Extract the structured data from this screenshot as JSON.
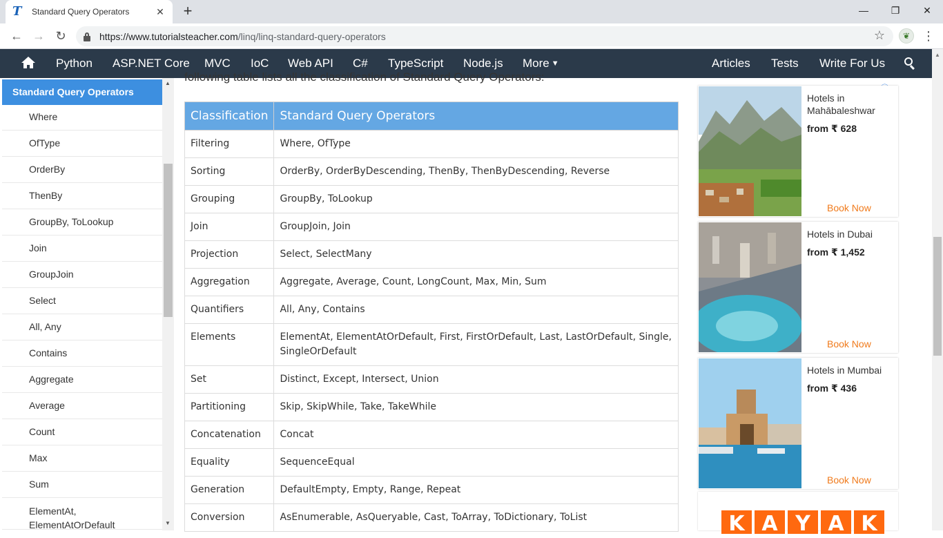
{
  "browser": {
    "tab_title": "Standard Query Operators",
    "url_host": "https://www.tutorialsteacher.com",
    "url_path": "/linq/linq-standard-query-operators"
  },
  "sitenav": {
    "items": [
      "Python",
      "ASP.NET Core",
      "MVC",
      "IoC",
      "Web API",
      "C#",
      "TypeScript",
      "Node.js",
      "More"
    ],
    "right_items": [
      "Articles",
      "Tests",
      "Write For Us"
    ]
  },
  "sidebar": {
    "header": "Standard Query Operators",
    "items": [
      "Where",
      "OfType",
      "OrderBy",
      "ThenBy",
      "GroupBy, ToLookup",
      "Join",
      "GroupJoin",
      "Select",
      "All, Any",
      "Contains",
      "Aggregate",
      "Average",
      "Count",
      "Max",
      "Sum"
    ],
    "last_item_line1": "ElementAt,",
    "last_item_line2": "ElementAtOrDefault"
  },
  "main": {
    "intro": "following table lists all the classification of Standard Query Operators:",
    "table_headers": [
      "Classification",
      "Standard Query Operators"
    ],
    "rows": [
      [
        "Filtering",
        "Where, OfType"
      ],
      [
        "Sorting",
        "OrderBy, OrderByDescending, ThenBy, ThenByDescending, Reverse"
      ],
      [
        "Grouping",
        "GroupBy, ToLookup"
      ],
      [
        "Join",
        "GroupJoin, Join"
      ],
      [
        "Projection",
        "Select, SelectMany"
      ],
      [
        "Aggregation",
        "Aggregate, Average, Count, LongCount, Max, Min, Sum"
      ],
      [
        "Quantifiers",
        "All, Any, Contains"
      ],
      [
        "Elements",
        "ElementAt, ElementAtOrDefault, First, FirstOrDefault, Last, LastOrDefault, Single, SingleOrDefault"
      ],
      [
        "Set",
        "Distinct, Except, Intersect, Union"
      ],
      [
        "Partitioning",
        "Skip, SkipWhile, Take, TakeWhile"
      ],
      [
        "Concatenation",
        "Concat"
      ],
      [
        "Equality",
        "SequenceEqual"
      ],
      [
        "Generation",
        "DefaultEmpty, Empty, Range, Repeat"
      ],
      [
        "Conversion",
        "AsEnumerable, AsQueryable, Cast, ToArray, ToDictionary, ToList"
      ]
    ]
  },
  "ads": {
    "cards": [
      {
        "name": "Hotels in Mahābaleshwar",
        "price": "from ₹ 628",
        "cta": "Book Now"
      },
      {
        "name": "Hotels in Dubai",
        "price": "from ₹ 1,452",
        "cta": "Book Now"
      },
      {
        "name": "Hotels in Mumbai",
        "price": "from ₹ 436",
        "cta": "Book Now"
      }
    ],
    "kayak_letters": [
      "K",
      "A",
      "Y",
      "A",
      "K"
    ]
  },
  "colors": {
    "nav_bg": "#2b3a4a",
    "sidebar_header": "#3d8fe0",
    "table_header": "#64a7e3",
    "book_now": "#f07a1b",
    "kayak": "#ff690f"
  },
  "icons": [
    "tutorialsteacher-favicon",
    "close-icon",
    "plus-icon",
    "back-arrow-icon",
    "forward-arrow-icon",
    "reload-icon",
    "lock-icon",
    "star-icon",
    "extension-icon",
    "menu-dots-icon",
    "home-icon",
    "caret-down-icon",
    "search-icon",
    "adchoices-icon"
  ]
}
